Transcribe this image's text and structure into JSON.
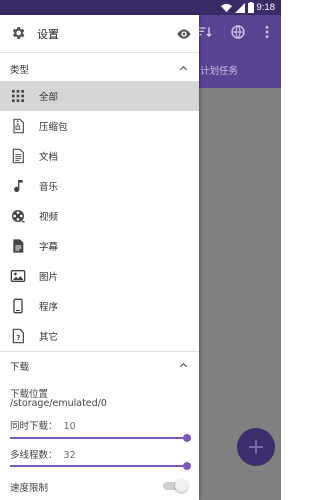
{
  "status_bar": {
    "time": "9:18",
    "icons": [
      "wifi-icon",
      "signal-icon",
      "battery-icon"
    ]
  },
  "background_app": {
    "toolbar_icons": [
      "sort-icon",
      "globe-icon",
      "more-vert-icon"
    ],
    "tab_label": "计划任务",
    "fab_icon": "plus-icon",
    "colors": {
      "toolbar": "#5b4394",
      "fab": "#3e2d6e",
      "scrim": "#808080"
    }
  },
  "drawer": {
    "header": {
      "title": "设置",
      "icon": "gear-icon",
      "action_icon": "eye-icon"
    },
    "type_section": {
      "label": "类型",
      "expanded": true,
      "items": [
        {
          "label": "全部",
          "icon": "grid-icon",
          "selected": true
        },
        {
          "label": "压缩包",
          "icon": "archive-icon",
          "selected": false
        },
        {
          "label": "文档",
          "icon": "document-icon",
          "selected": false
        },
        {
          "label": "音乐",
          "icon": "music-note-icon",
          "selected": false
        },
        {
          "label": "视频",
          "icon": "film-reel-icon",
          "selected": false
        },
        {
          "label": "字幕",
          "icon": "subtitle-file-icon",
          "selected": false
        },
        {
          "label": "图片",
          "icon": "image-icon",
          "selected": false
        },
        {
          "label": "程序",
          "icon": "phone-icon",
          "selected": false
        },
        {
          "label": "其它",
          "icon": "unknown-file-icon",
          "selected": false
        }
      ]
    },
    "download_section": {
      "label": "下载",
      "expanded": true,
      "location_label": "下载位置",
      "location_path": "/storage/emulated/0",
      "concurrent_label": "同时下载：",
      "concurrent_value": "10",
      "concurrent_fraction": 1.0,
      "threads_label": "多线程数：",
      "threads_value": "32",
      "threads_fraction": 1.0,
      "speed_limit_label": "速度限制",
      "speed_limit_enabled": false
    },
    "accent_color": "#7e57c2"
  }
}
